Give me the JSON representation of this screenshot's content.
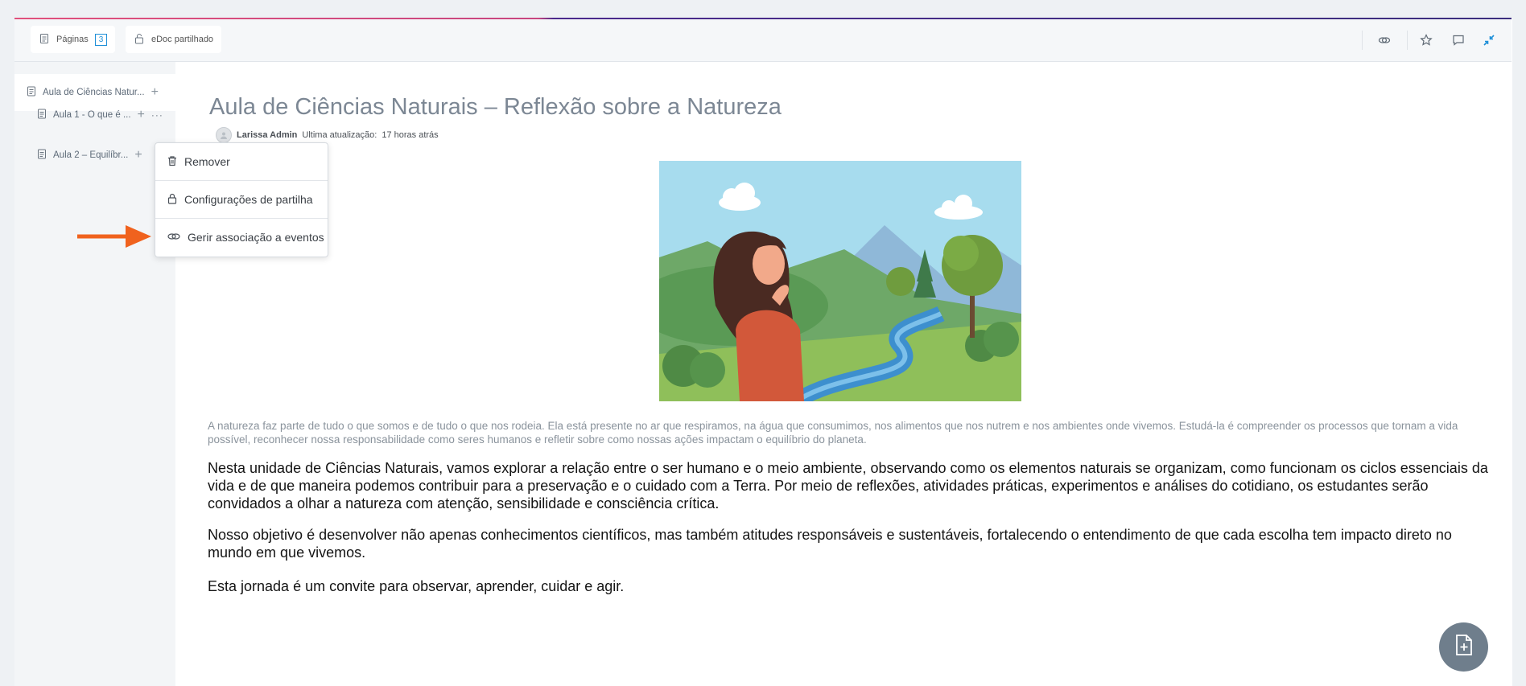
{
  "toolbar": {
    "pages_label": "Páginas",
    "pages_count": "3",
    "shared_label": "eDoc partilhado"
  },
  "sidebar": {
    "root_label": "Aula de Ciências Natur...",
    "items": [
      {
        "label": "Aula 1 - O que é ..."
      },
      {
        "label": "Aula 2 – Equilíbr..."
      }
    ]
  },
  "context_menu": {
    "items": [
      {
        "label": "Remover",
        "icon": "trash-icon"
      },
      {
        "label": "Configurações de partilha",
        "icon": "lock-icon"
      },
      {
        "label": "Gerir associação a eventos",
        "icon": "link-icon"
      }
    ]
  },
  "document": {
    "title": "Aula de Ciências Naturais – Reflexão sobre a Natureza",
    "author": "Larissa Admin",
    "updated_label": "Ultima atualização:",
    "updated_value": "17 horas atrás",
    "caption": "A natureza faz parte de tudo o que somos e de tudo o que nos rodeia. Ela está presente no ar que respiramos, na água que consumimos, nos alimentos que nos nutrem e nos ambientes onde vivemos. Estudá-la é compreender os processos que tornam a vida possível, reconhecer nossa responsabilidade como seres humanos e refletir sobre como nossas ações impactam o equilíbrio do planeta.",
    "paragraphs": [
      "Nesta unidade de Ciências Naturais, vamos explorar a relação entre o ser humano e o meio ambiente, observando como os elementos naturais se organizam, como funcionam os ciclos essenciais da vida e de que maneira podemos contribuir para a preservação e o cuidado com a Terra. Por meio de reflexões, atividades práticas, experimentos e análises do cotidiano, os estudantes serão convidados a olhar a natureza com atenção, sensibilidade e consciência crítica.",
      "Nosso objetivo é desenvolver não apenas conhecimentos científicos, mas também atitudes responsáveis e sustentáveis, fortalecendo o entendimento de que cada escolha tem impacto direto no mundo em que vivemos.",
      "Esta jornada é um convite para observar, aprender, cuidar e agir."
    ]
  },
  "colors": {
    "accent": "#1e8fd8",
    "arrow": "#f0621e",
    "fab": "#6f7e8c"
  }
}
